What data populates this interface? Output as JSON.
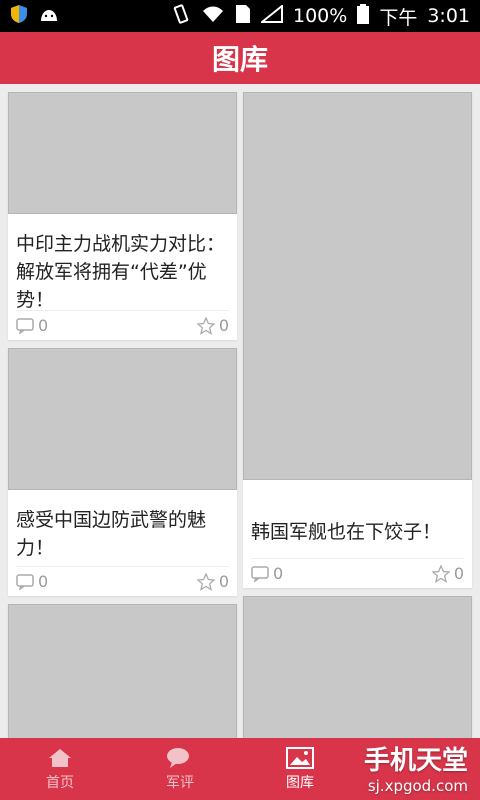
{
  "status_bar": {
    "left_icons": [
      "shield-icon",
      "android-icon"
    ],
    "battery": "100%",
    "time_prefix": "下午",
    "time": "3:01"
  },
  "title": "图库",
  "cards": [
    {
      "title": "中印主力战机实力对比：解放军将拥有“代差”优势！",
      "comments": "0",
      "likes": "0"
    },
    {
      "title": "韩国军舰也在下饺子！",
      "comments": "0",
      "likes": "0"
    },
    {
      "title": "感受中国边防武警的魅力！",
      "comments": "0",
      "likes": "0"
    }
  ],
  "bottom_nav": [
    {
      "label": "首页",
      "icon": "home-icon"
    },
    {
      "label": "军评",
      "icon": "chat-icon"
    },
    {
      "label": "图库",
      "icon": "gallery-icon"
    }
  ],
  "watermark": {
    "brand": "手机天堂",
    "url": "sj.xpgod.com"
  },
  "colors": {
    "accent": "#d8354a",
    "background": "#ececec"
  }
}
